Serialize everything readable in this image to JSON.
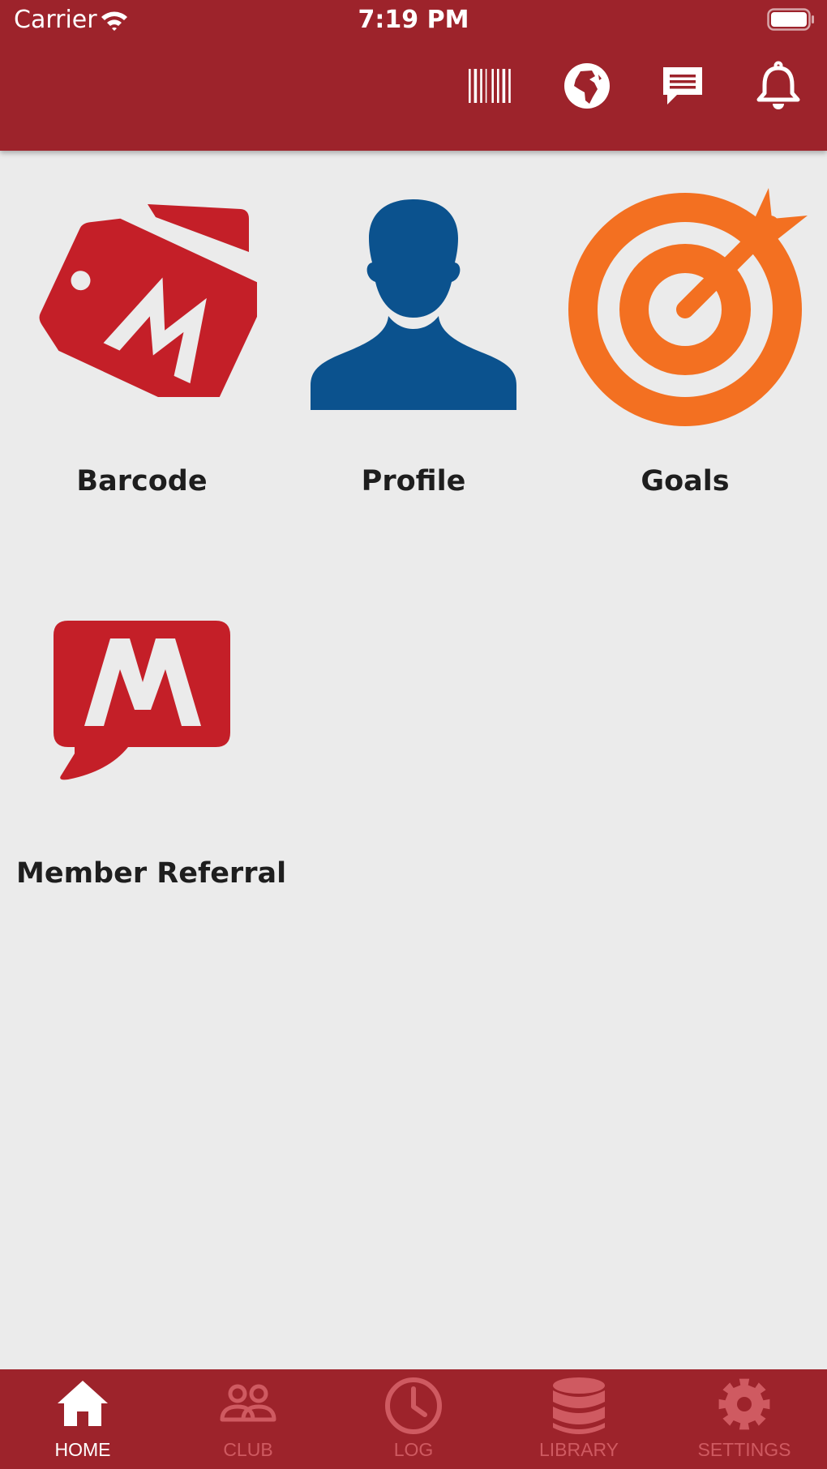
{
  "colors": {
    "header_bg": "#9d232b",
    "page_bg": "#ebebeb",
    "brand_red": "#c41f28",
    "profile_blue": "#0b528e",
    "goals_orange": "#f37021",
    "tab_inactive": "#cf5a61",
    "tab_active": "#ffffff"
  },
  "status_bar": {
    "carrier": "Carrier",
    "time": "7:19 PM"
  },
  "header_actions": [
    {
      "name": "barcode",
      "icon": "barcode-icon"
    },
    {
      "name": "globe",
      "icon": "globe-icon"
    },
    {
      "name": "messages",
      "icon": "chat-icon"
    },
    {
      "name": "notifications",
      "icon": "bell-icon"
    }
  ],
  "tiles": [
    {
      "label": "Barcode",
      "icon": "tag-m-icon"
    },
    {
      "label": "Profile",
      "icon": "person-icon"
    },
    {
      "label": "Goals",
      "icon": "target-icon"
    },
    {
      "label": "Member Referral",
      "icon": "chat-m-icon"
    }
  ],
  "tabbar": {
    "active": "HOME",
    "tabs": [
      {
        "label": "HOME",
        "icon": "home-icon"
      },
      {
        "label": "CLUB",
        "icon": "group-icon"
      },
      {
        "label": "LOG",
        "icon": "clock-icon"
      },
      {
        "label": "LIBRARY",
        "icon": "database-icon"
      },
      {
        "label": "SETTINGS",
        "icon": "gear-icon"
      }
    ]
  }
}
